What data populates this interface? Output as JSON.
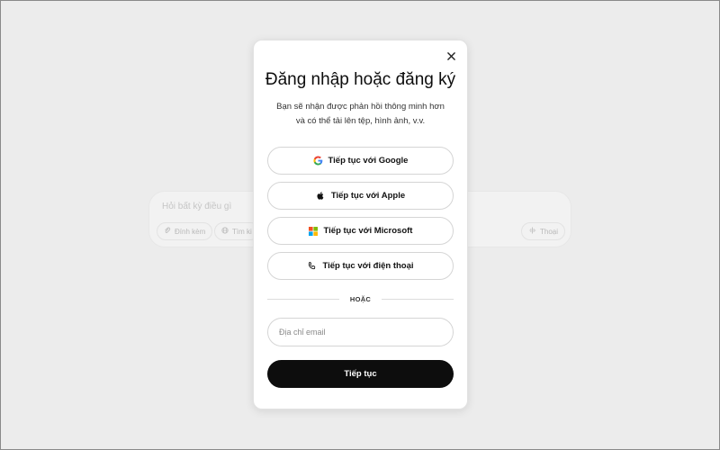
{
  "background": {
    "composer_placeholder": "Hỏi bất kỳ điều gì",
    "chips": {
      "attach": "Đính kèm",
      "search": "Tìm ki",
      "voice": "Thoại"
    }
  },
  "modal": {
    "title": "Đăng nhập hoặc đăng ký",
    "subtitle": "Bạn sẽ nhận được phản hồi thông minh hơn và có thể tải lên tệp, hình ảnh, v.v.",
    "oauth": {
      "google": "Tiếp tục với Google",
      "apple": "Tiếp tục với Apple",
      "microsoft": "Tiếp tục với Microsoft",
      "phone": "Tiếp tục với điện thoại"
    },
    "divider": "HOẶC",
    "email_placeholder": "Địa chỉ email",
    "email_value": "",
    "continue_label": "Tiếp tục"
  },
  "colors": {
    "primary_button": "#0d0d0d",
    "page_background": "#ececec"
  }
}
